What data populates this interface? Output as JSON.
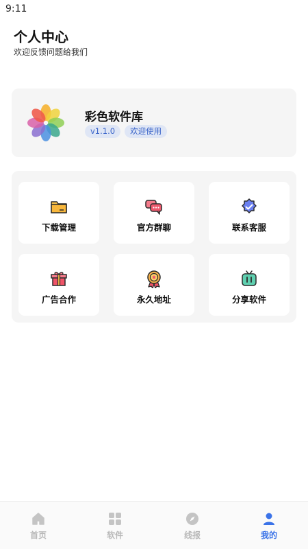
{
  "status_bar": {
    "time": "9:11"
  },
  "header": {
    "title": "个人中心",
    "subtitle": "欢迎反馈问题给我们"
  },
  "app_card": {
    "name": "彩色软件库",
    "version": "v1.1.0",
    "welcome": "欢迎使用",
    "logo_icon": "colorful-petal-logo"
  },
  "grid": {
    "items": [
      {
        "label": "下载管理",
        "icon": "folder-icon"
      },
      {
        "label": "官方群聊",
        "icon": "chat-bubbles-icon"
      },
      {
        "label": "联系客服",
        "icon": "verified-badge-icon"
      },
      {
        "label": "广告合作",
        "icon": "gift-icon"
      },
      {
        "label": "永久地址",
        "icon": "medal-icon"
      },
      {
        "label": "分享软件",
        "icon": "tv-icon"
      }
    ]
  },
  "bottom_nav": {
    "items": [
      {
        "label": "首页",
        "icon": "home-icon"
      },
      {
        "label": "软件",
        "icon": "grid-icon"
      },
      {
        "label": "线报",
        "icon": "compass-icon"
      },
      {
        "label": "我的",
        "icon": "person-icon"
      }
    ],
    "active_index": 3
  },
  "colors": {
    "accent": "#3b73e8",
    "panel": "#f5f5f5",
    "badge_bg": "#dfe6f5",
    "badge_text": "#3a64c9"
  }
}
